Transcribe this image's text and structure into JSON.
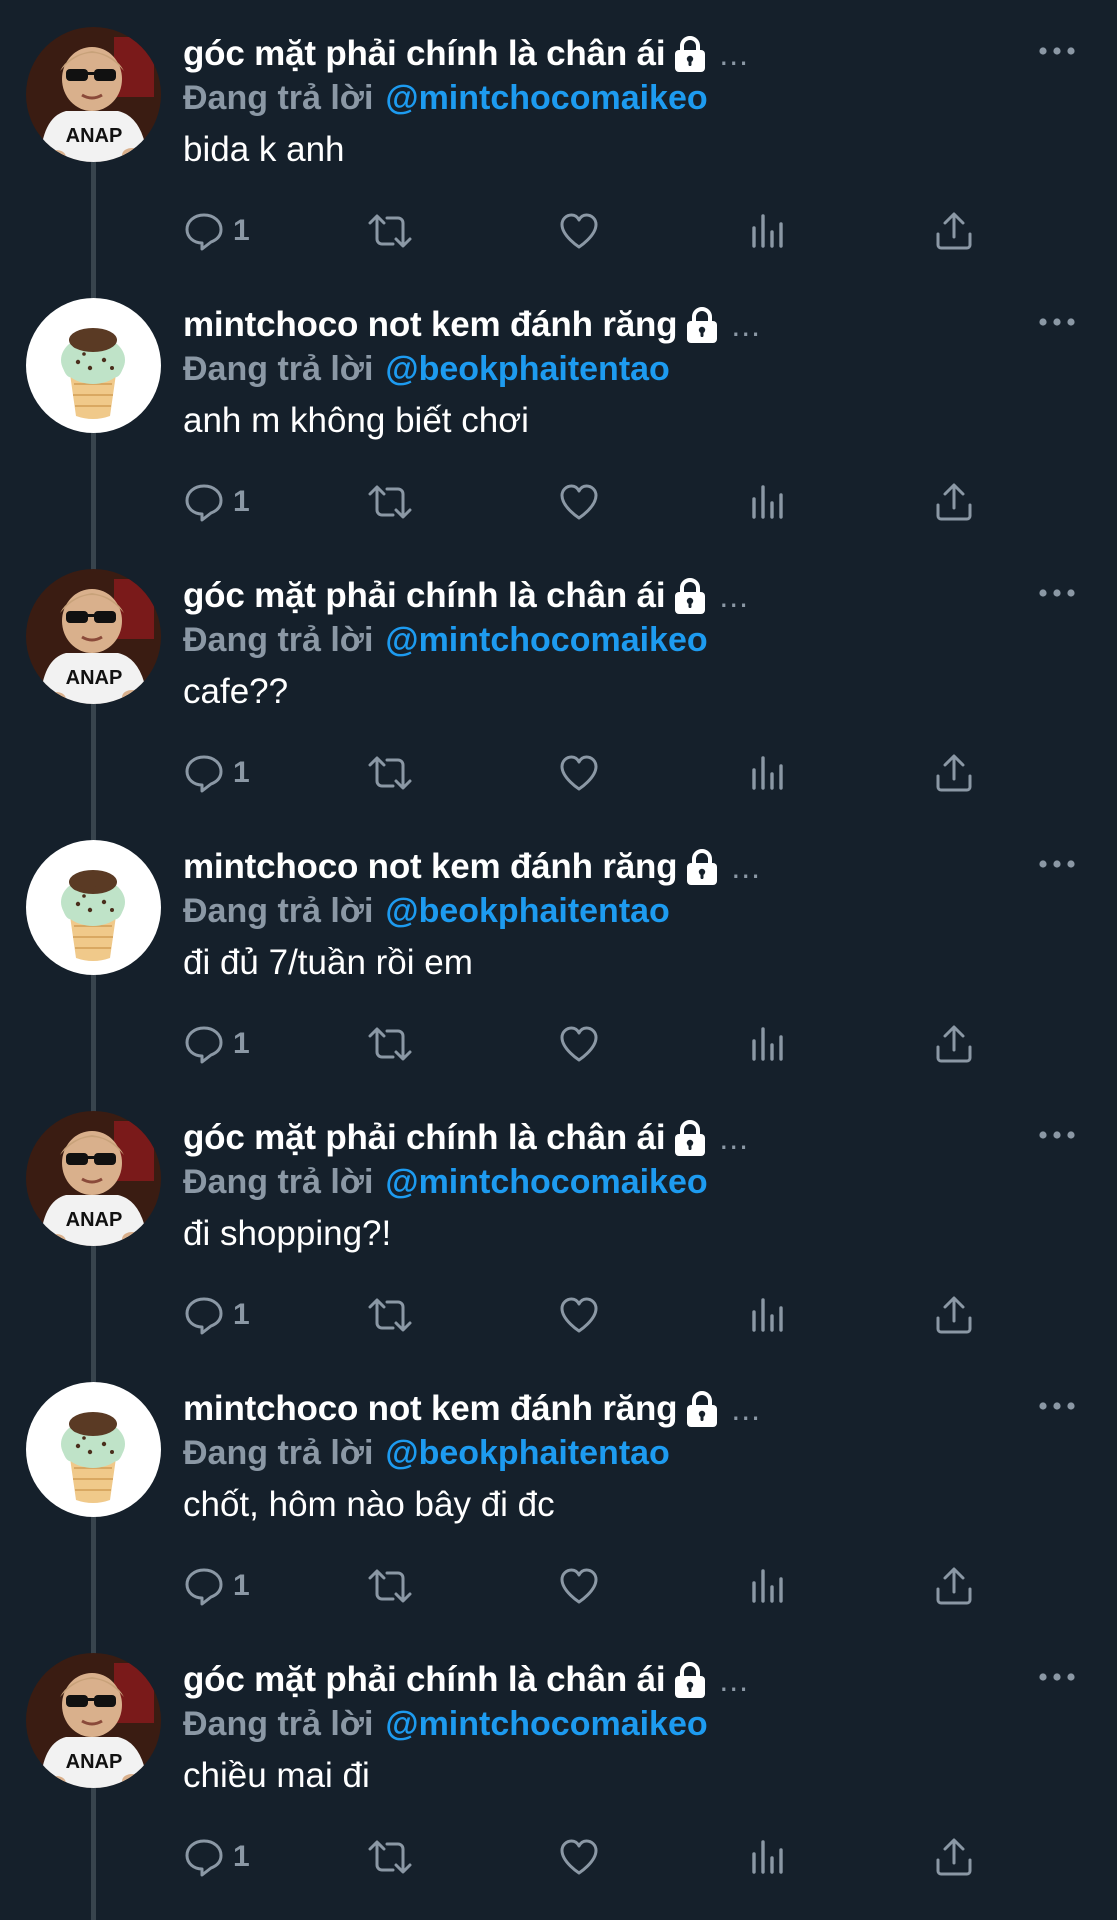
{
  "colors": {
    "background": "#15202b",
    "secondary_text": "#8b98a5",
    "link": "#1d9bf0",
    "thread_line": "#38444d"
  },
  "tweets": [
    {
      "name": "góc mặt phải chính là chân ái",
      "name_ellipsis": "...",
      "reply_prefix": "Đang trả lời",
      "reply_handle": "@mintchocomaikeo",
      "text": "bida k anh",
      "reply_count": "1",
      "avatar": "kid-sunglasses"
    },
    {
      "name": "mintchoco not kem đánh răng",
      "name_ellipsis": "...",
      "reply_prefix": "Đang trả lời",
      "reply_handle": "@beokphaitentao",
      "text": "anh m không biết chơi",
      "reply_count": "1",
      "avatar": "mint-ice-cream"
    },
    {
      "name": "góc mặt phải chính là chân ái",
      "name_ellipsis": "...",
      "reply_prefix": "Đang trả lời",
      "reply_handle": "@mintchocomaikeo",
      "text": "cafe??",
      "reply_count": "1",
      "avatar": "kid-sunglasses"
    },
    {
      "name": "mintchoco not kem đánh răng",
      "name_ellipsis": "...",
      "reply_prefix": "Đang trả lời",
      "reply_handle": "@beokphaitentao",
      "text": "đi đủ 7/tuần rồi em",
      "reply_count": "1",
      "avatar": "mint-ice-cream"
    },
    {
      "name": "góc mặt phải chính là chân ái",
      "name_ellipsis": "...",
      "reply_prefix": "Đang trả lời",
      "reply_handle": "@mintchocomaikeo",
      "text": "đi shopping?!",
      "reply_count": "1",
      "avatar": "kid-sunglasses"
    },
    {
      "name": "mintchoco not kem đánh răng",
      "name_ellipsis": "...",
      "reply_prefix": "Đang trả lời",
      "reply_handle": "@beokphaitentao",
      "text": "chốt, hôm nào bây đi đc",
      "reply_count": "1",
      "avatar": "mint-ice-cream"
    },
    {
      "name": "góc mặt phải chính là chân ái",
      "name_ellipsis": "...",
      "reply_prefix": "Đang trả lời",
      "reply_handle": "@mintchocomaikeo",
      "text": "chiều mai đi",
      "reply_count": "1",
      "avatar": "kid-sunglasses"
    }
  ],
  "avatar_texts": {
    "kid-sunglasses": "ANAP"
  }
}
